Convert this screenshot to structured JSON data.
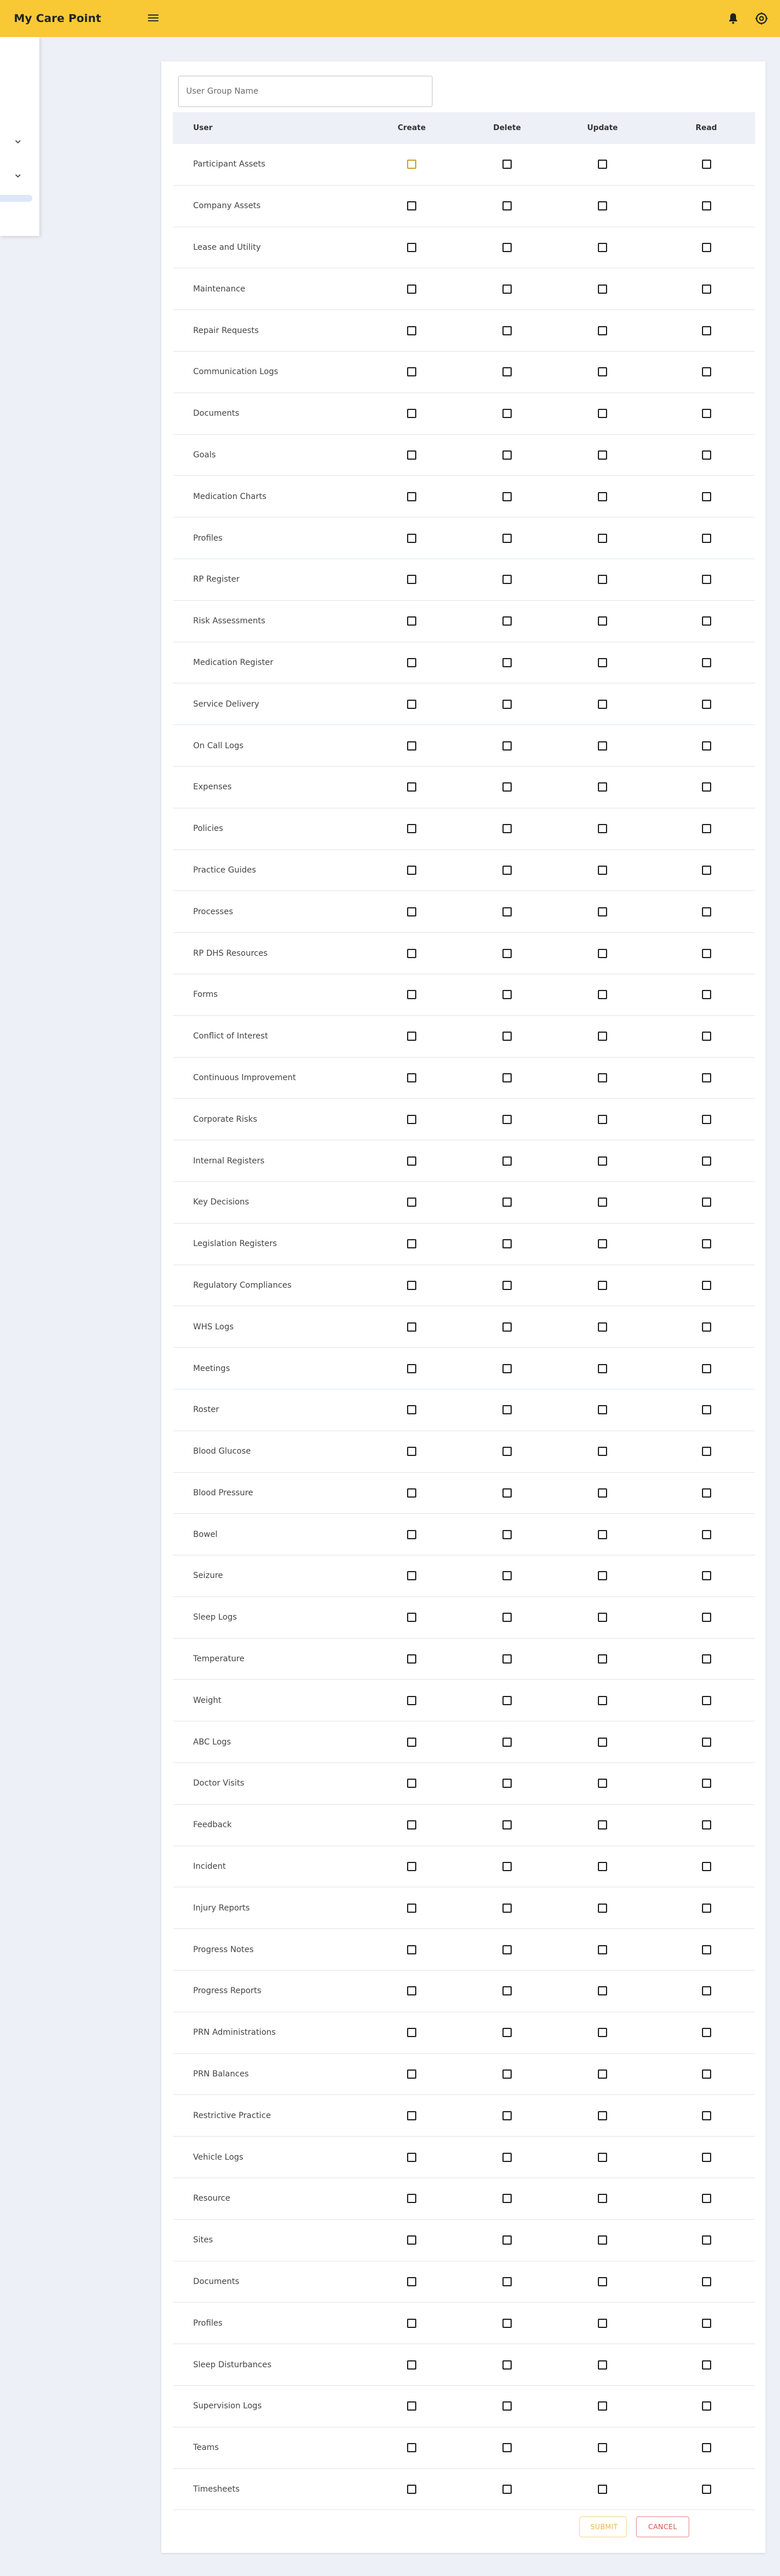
{
  "header": {
    "brand": "My Care Point",
    "menu_icon": "hamburger-menu-icon",
    "notification_icon": "bell-icon",
    "settings_icon": "gear-icon"
  },
  "form": {
    "group_name_placeholder": "User Group Name",
    "group_name_value": ""
  },
  "table": {
    "columns": [
      "User",
      "Create",
      "Delete",
      "Update",
      "Read"
    ],
    "rows": [
      {
        "label": "Participant Assets"
      },
      {
        "label": "Company Assets"
      },
      {
        "label": "Lease and Utility"
      },
      {
        "label": "Maintenance"
      },
      {
        "label": "Repair Requests"
      },
      {
        "label": "Communication Logs"
      },
      {
        "label": "Documents"
      },
      {
        "label": "Goals"
      },
      {
        "label": "Medication Charts"
      },
      {
        "label": "Profiles"
      },
      {
        "label": "RP Register"
      },
      {
        "label": "Risk Assessments"
      },
      {
        "label": "Medication Register"
      },
      {
        "label": "Service Delivery"
      },
      {
        "label": "On Call Logs"
      },
      {
        "label": "Expenses"
      },
      {
        "label": "Policies"
      },
      {
        "label": "Practice Guides"
      },
      {
        "label": "Processes"
      },
      {
        "label": "RP DHS Resources"
      },
      {
        "label": "Forms"
      },
      {
        "label": "Conflict of Interest"
      },
      {
        "label": "Continuous Improvement"
      },
      {
        "label": "Corporate Risks"
      },
      {
        "label": "Internal Registers"
      },
      {
        "label": "Key Decisions"
      },
      {
        "label": "Legislation Registers"
      },
      {
        "label": "Regulatory Compliances"
      },
      {
        "label": "WHS Logs"
      },
      {
        "label": "Meetings"
      },
      {
        "label": "Roster"
      },
      {
        "label": "Blood Glucose"
      },
      {
        "label": "Blood Pressure"
      },
      {
        "label": "Bowel"
      },
      {
        "label": "Seizure"
      },
      {
        "label": "Sleep Logs"
      },
      {
        "label": "Temperature"
      },
      {
        "label": "Weight"
      },
      {
        "label": "ABC Logs"
      },
      {
        "label": "Doctor Visits"
      },
      {
        "label": "Feedback"
      },
      {
        "label": "Incident"
      },
      {
        "label": "Injury Reports"
      },
      {
        "label": "Progress Notes"
      },
      {
        "label": "Progress Reports"
      },
      {
        "label": "PRN Administrations"
      },
      {
        "label": "PRN Balances"
      },
      {
        "label": "Restrictive Practice"
      },
      {
        "label": "Vehicle Logs"
      },
      {
        "label": "Resource"
      },
      {
        "label": "Sites"
      },
      {
        "label": "Documents"
      },
      {
        "label": "Profiles"
      },
      {
        "label": "Sleep Disturbances"
      },
      {
        "label": "Supervision Logs"
      },
      {
        "label": "Teams"
      },
      {
        "label": "Timesheets"
      }
    ]
  },
  "actions": {
    "submit_label": "SUBMIT",
    "cancel_label": "CANCEL"
  },
  "colors": {
    "topbar": "#f8c935",
    "background": "#eef0f7",
    "submit": "#f2b745",
    "cancel": "#d9534f"
  }
}
